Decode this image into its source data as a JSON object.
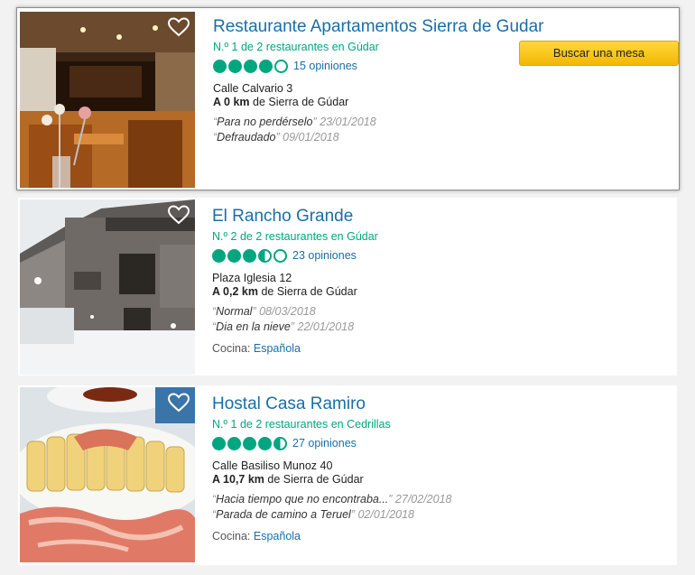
{
  "listings": [
    {
      "name": "Restaurante Apartamentos Sierra de Gudar",
      "rank": "N.º 1 de 2 restaurantes en Gúdar",
      "rating": 4,
      "reviews": "15 opiniones",
      "address": "Calle Calvario 3",
      "distance_value": "A 0 km",
      "distance_suffix": "de Sierra de Gúdar",
      "quotes": [
        {
          "text": "Para no perdérselo",
          "date": "23/01/2018"
        },
        {
          "text": "Defraudado",
          "date": "09/01/2018"
        }
      ],
      "button": "Buscar una mesa"
    },
    {
      "name": "El Rancho Grande",
      "rank": "N.º 2 de 2 restaurantes en Gúdar",
      "rating": 3.5,
      "reviews": "23 opiniones",
      "address": "Plaza Iglesia 12",
      "distance_value": "A 0,2 km",
      "distance_suffix": "de Sierra de Gúdar",
      "quotes": [
        {
          "text": "Normal",
          "date": "08/03/2018"
        },
        {
          "text": "Dia en la nieve",
          "date": "22/01/2018"
        }
      ],
      "cuisine_label": "Cocina:",
      "cuisine": "Española"
    },
    {
      "name": "Hostal Casa Ramiro",
      "rank": "N.º 1 de 2 restaurantes en Cedrillas",
      "rating": 4.5,
      "reviews": "27 opiniones",
      "address": "Calle Basiliso Munoz 40",
      "distance_value": "A 10,7 km",
      "distance_suffix": "de Sierra de Gúdar",
      "quotes": [
        {
          "text": "Hacia tiempo que no encontraba...",
          "date": "27/02/2018"
        },
        {
          "text": "Parada de camino a Teruel",
          "date": "02/01/2018"
        }
      ],
      "cuisine_label": "Cocina:",
      "cuisine": "Española"
    }
  ],
  "colors": {
    "link": "#1a6ea8",
    "accent_green": "#00a680",
    "button_yellow": "#ffc81e"
  },
  "icons": {
    "save": "heart-icon",
    "rating": "rating-bubble-icon"
  }
}
